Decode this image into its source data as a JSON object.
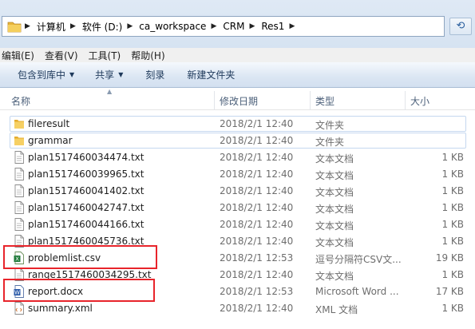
{
  "address": {
    "crumbs": [
      "计算机",
      "软件 (D:)",
      "ca_workspace",
      "CRM",
      "Res1"
    ],
    "refresh_icon": "refresh-icon"
  },
  "menu": [
    "编辑(E)",
    "查看(V)",
    "工具(T)",
    "帮助(H)"
  ],
  "toolbar": {
    "include_label": "包含到库中",
    "share_label": "共享",
    "burn_label": "刻录",
    "new_folder_label": "新建文件夹"
  },
  "columns": {
    "name": "名称",
    "date": "修改日期",
    "type": "类型",
    "size": "大小"
  },
  "files": [
    {
      "name": "fileresult",
      "date": "2018/2/1 12:40",
      "type": "文件夹",
      "size": "",
      "icon": "folder"
    },
    {
      "name": "grammar",
      "date": "2018/2/1 12:40",
      "type": "文件夹",
      "size": "",
      "icon": "folder"
    },
    {
      "name": "plan1517460034474.txt",
      "date": "2018/2/1 12:40",
      "type": "文本文档",
      "size": "1 KB",
      "icon": "text"
    },
    {
      "name": "plan1517460039965.txt",
      "date": "2018/2/1 12:40",
      "type": "文本文档",
      "size": "1 KB",
      "icon": "text"
    },
    {
      "name": "plan1517460041402.txt",
      "date": "2018/2/1 12:40",
      "type": "文本文档",
      "size": "1 KB",
      "icon": "text"
    },
    {
      "name": "plan1517460042747.txt",
      "date": "2018/2/1 12:40",
      "type": "文本文档",
      "size": "1 KB",
      "icon": "text"
    },
    {
      "name": "plan1517460044166.txt",
      "date": "2018/2/1 12:40",
      "type": "文本文档",
      "size": "1 KB",
      "icon": "text"
    },
    {
      "name": "plan1517460045736.txt",
      "date": "2018/2/1 12:40",
      "type": "文本文档",
      "size": "1 KB",
      "icon": "text"
    },
    {
      "name": "problemlist.csv",
      "date": "2018/2/1 12:53",
      "type": "逗号分隔符CSV文...",
      "size": "19 KB",
      "icon": "excel"
    },
    {
      "name": "range1517460034295.txt",
      "date": "2018/2/1 12:40",
      "type": "文本文档",
      "size": "1 KB",
      "icon": "text"
    },
    {
      "name": "report.docx",
      "date": "2018/2/1 12:53",
      "type": "Microsoft Word ...",
      "size": "17 KB",
      "icon": "word"
    },
    {
      "name": "summary.xml",
      "date": "2018/2/1 12:40",
      "type": "XML 文档",
      "size": "1 KB",
      "icon": "xml"
    }
  ],
  "colors": {
    "highlight_box": "#e8242b",
    "folder_yellow": "#f0c24a"
  }
}
